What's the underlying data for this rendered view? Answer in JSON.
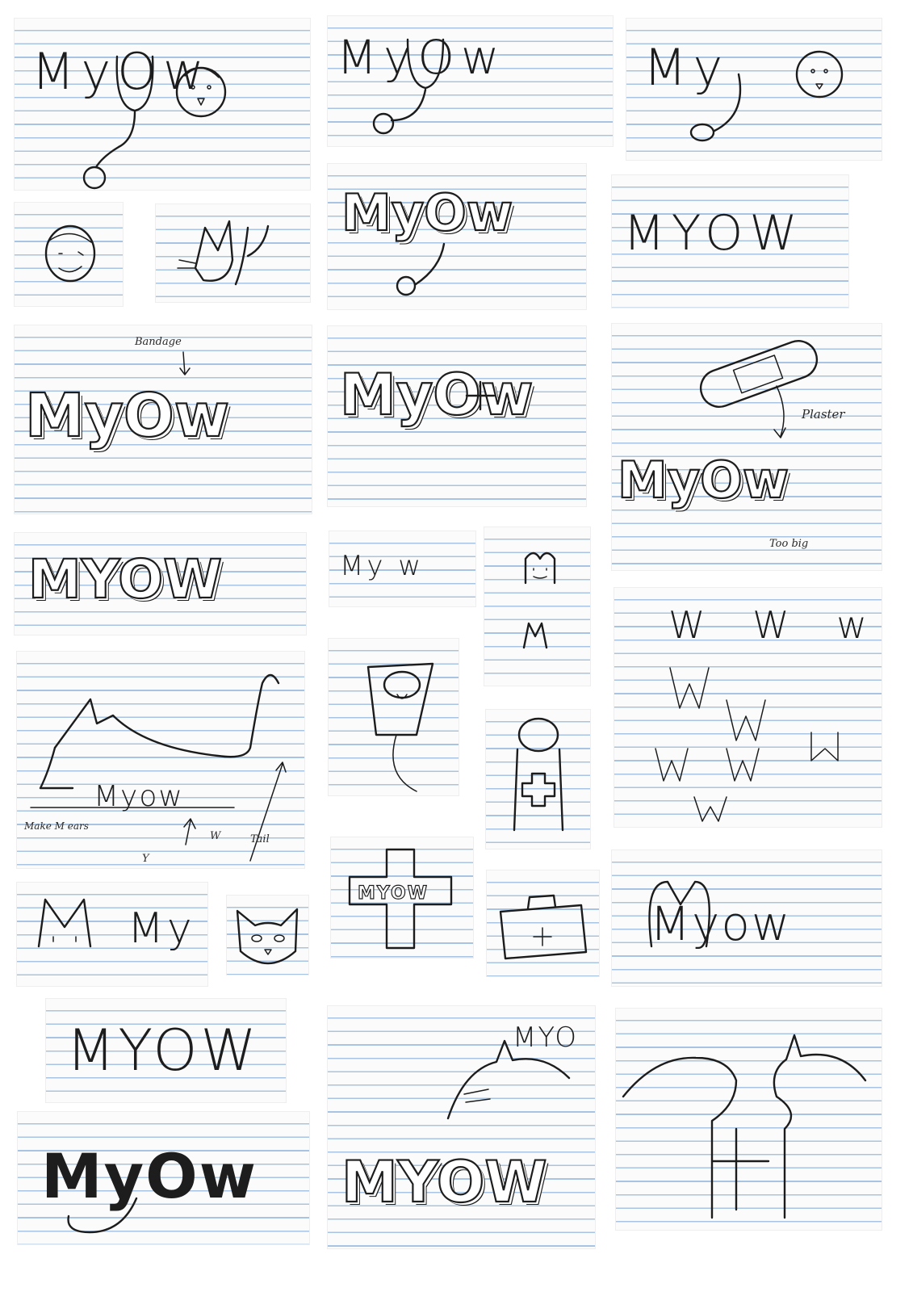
{
  "logo_word": "MYOW",
  "logo_word_mixed": "MyOw",
  "sketches": [
    {
      "id": "s1",
      "text": "MyOw"
    },
    {
      "id": "s2",
      "text": "MyOw"
    },
    {
      "id": "s3",
      "text": "My"
    },
    {
      "id": "s6",
      "text": "MyOw"
    },
    {
      "id": "s7",
      "text": "MYOW"
    },
    {
      "id": "s8",
      "text": "MyOw",
      "annotation": "Bandage"
    },
    {
      "id": "s9",
      "text": "MyOw"
    },
    {
      "id": "s10",
      "text": "MyOw",
      "annotations": [
        "Plaster",
        "Too big"
      ]
    },
    {
      "id": "s11",
      "text": "MYOW"
    },
    {
      "id": "s12",
      "text": "My w"
    },
    {
      "id": "s14",
      "text": "W W w"
    },
    {
      "id": "s15",
      "text": "Myow",
      "annotations": [
        "Make M ears",
        "W",
        "Tail",
        "Y"
      ]
    },
    {
      "id": "s18",
      "text": "My"
    },
    {
      "id": "s20",
      "text": "MYOW"
    },
    {
      "id": "s22",
      "text": "Myow"
    },
    {
      "id": "s23",
      "text": "MYOW"
    },
    {
      "id": "s24",
      "text": "MyOw"
    },
    {
      "id": "s25",
      "text": "MYOW",
      "small": "MYO"
    }
  ]
}
